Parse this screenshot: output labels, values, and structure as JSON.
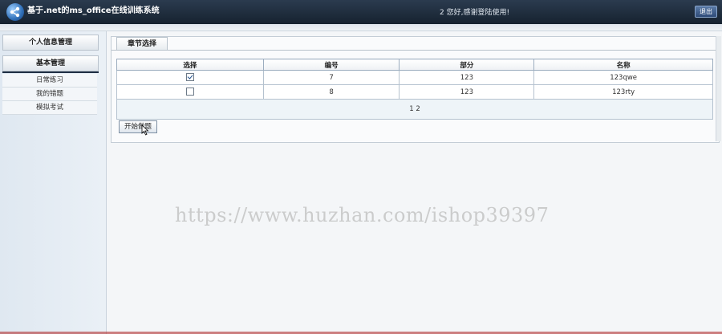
{
  "header": {
    "title": "基于.net的ms_office在线训练系统",
    "welcome": "2 您好,感谢登陆使用!",
    "logout_label": "退出"
  },
  "sidebar": {
    "sections": [
      {
        "label": "个人信息管理"
      },
      {
        "label": "基本管理"
      }
    ],
    "items": [
      {
        "label": "日常练习"
      },
      {
        "label": "我的错题"
      },
      {
        "label": "模拟考试"
      }
    ]
  },
  "main": {
    "tab_label": "章节选择",
    "table": {
      "headers": [
        "选择",
        "编号",
        "部分",
        "名称"
      ],
      "rows": [
        {
          "checked": true,
          "id": "7",
          "part": "123",
          "name": "123qwe"
        },
        {
          "checked": false,
          "id": "8",
          "part": "123",
          "name": "123rty"
        }
      ],
      "pager": "1 2"
    },
    "start_button": "开始做题"
  },
  "watermark": "https://www.huzhan.com/ishop39397",
  "colors": {
    "header_bg": "#1f2d3d",
    "sidebar_bg": "#e4ecf4",
    "border": "#6f869f"
  }
}
